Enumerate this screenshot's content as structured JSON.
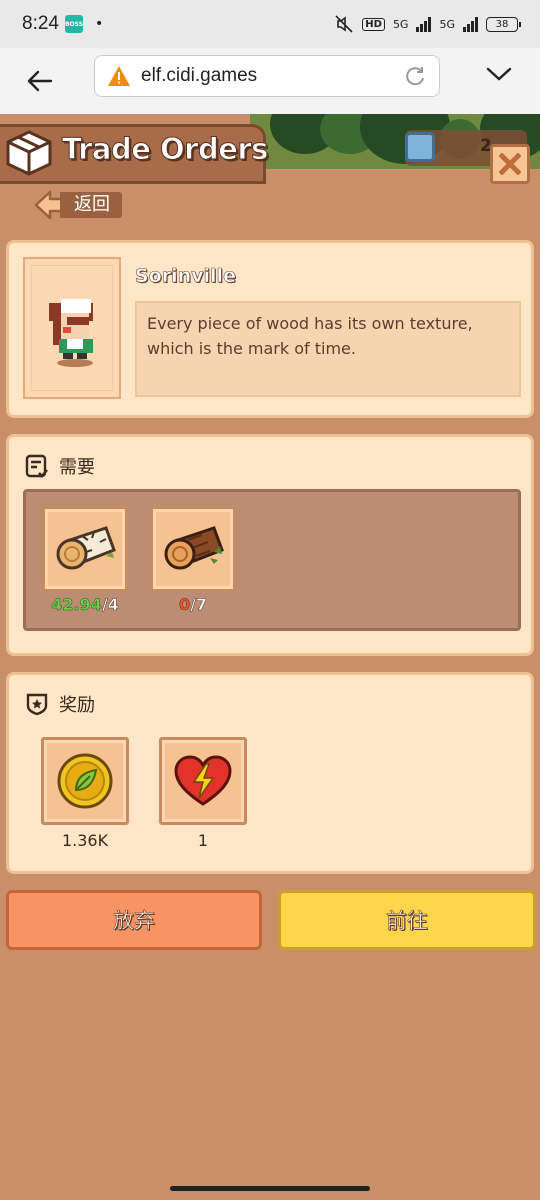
{
  "status_bar": {
    "time": "8:24",
    "app_badge": "BOSS",
    "network_1": "5G",
    "network_2": "5G",
    "hd_label": "HD",
    "battery": "38"
  },
  "browser": {
    "url": "elf.cidi.games"
  },
  "header": {
    "title": "Trade Orders",
    "energy_value": "2"
  },
  "back_button": {
    "label": "返回"
  },
  "npc": {
    "name": "Sorinville",
    "dialog": "Every piece of wood has its own texture, which is the mark of time."
  },
  "requirements": {
    "heading": "需要",
    "items": [
      {
        "icon": "birch-log-icon",
        "have": "42.94",
        "need": "/4",
        "status": "met"
      },
      {
        "icon": "oak-log-icon",
        "have": "0",
        "need": "/7",
        "status": "unmet"
      }
    ]
  },
  "rewards": {
    "heading": "奖励",
    "items": [
      {
        "icon": "leaf-coin-icon",
        "value": "1.36K"
      },
      {
        "icon": "energy-heart-icon",
        "value": "1"
      }
    ]
  },
  "actions": {
    "abandon_label": "放弃",
    "goto_label": "前往"
  },
  "colors": {
    "background": "#c98f68",
    "panel": "#ffe6c6",
    "abandon": "#f89463",
    "goto": "#fdd64c",
    "have_met": "#6bd24a",
    "have_unmet": "#e25a32"
  }
}
